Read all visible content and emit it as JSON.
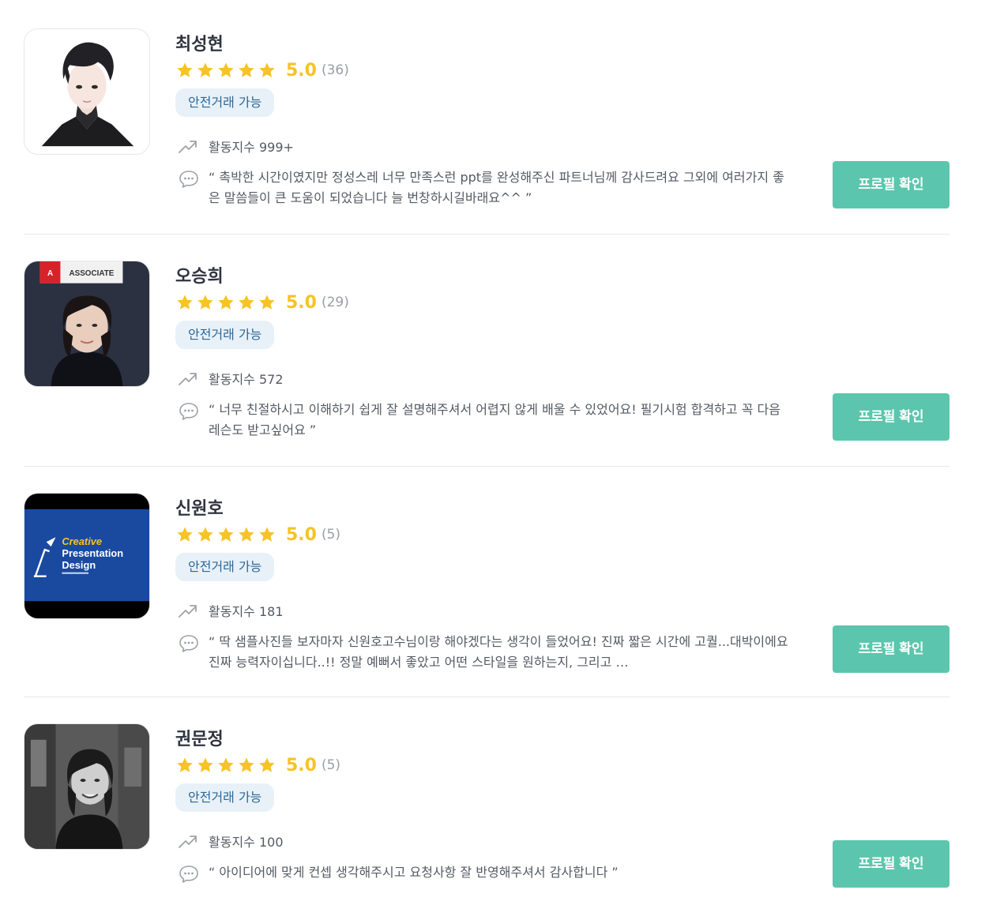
{
  "experts": [
    {
      "name": "최성현",
      "score": "5.0",
      "review_count": "(36)",
      "stars": 5,
      "badge": "안전거래 가능",
      "activity": "활동지수 999+",
      "review": "“ 촉박한 시간이였지만 정성스레 너무 만족스런 ppt를 완성해주신 파트너님께 감사드려요 그외에 여러가지 좋은 말씀들이 큰 도움이 되었습니다 늘 번창하시길바래요^^ ”",
      "button": "프로필 확인",
      "avatar_icon": "illustrated-portrait"
    },
    {
      "name": "오승희",
      "score": "5.0",
      "review_count": "(29)",
      "stars": 5,
      "badge": "안전거래 가능",
      "activity": "활동지수 572",
      "review": "“ 너무 친절하시고 이해하기 쉽게 잘 설명해주셔서 어렵지 않게 배울 수 있었어요! 필기시험 합격하고 꼭 다음 레슨도 받고싶어요 ”",
      "button": "프로필 확인",
      "avatar_icon": "photo-portrait",
      "avatar_text": [
        "ASSOCIATE"
      ]
    },
    {
      "name": "신원호",
      "score": "5.0",
      "review_count": "(5)",
      "stars": 5,
      "badge": "안전거래 가능",
      "activity": "활동지수 181",
      "review": "“ 딱 샘플사진들 보자마자 신원호고수님이랑 해야겠다는 생각이 들었어요! 진짜 짧은 시간에 고퀄...대박이에요 진짜 능력자이십니다..!! 정말 예뻐서 좋았고 어떤 스타일을 원하는지, 그리고 …",
      "button": "프로필 확인",
      "avatar_icon": "logo-image",
      "avatar_text": [
        "Creative",
        "Presentation",
        "Design"
      ]
    },
    {
      "name": "권문정",
      "score": "5.0",
      "review_count": "(5)",
      "stars": 5,
      "badge": "안전거래 가능",
      "activity": "활동지수 100",
      "review": "“ 아이디어에 맞게 컨셉 생각해주시고 요청사항 잘 반영해주셔서 감사합니다 ”",
      "button": "프로필 확인",
      "avatar_icon": "photo-portrait-bw"
    }
  ],
  "colors": {
    "star": "#f7c325",
    "badge_bg": "#e8f1f8",
    "badge_text": "#2f6795",
    "button": "#5bc6ad",
    "divider": "#e6e8ec"
  }
}
